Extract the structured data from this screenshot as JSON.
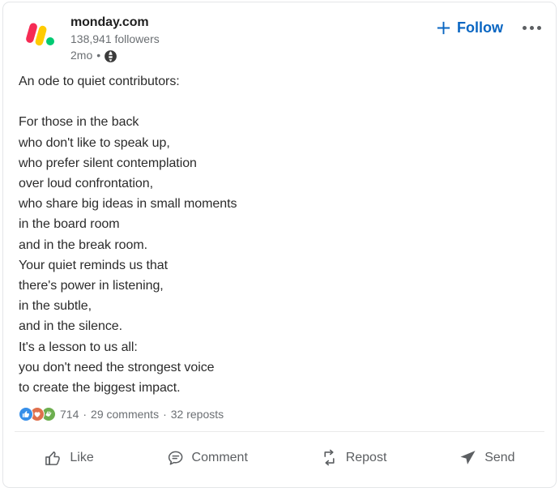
{
  "post": {
    "author": {
      "name": "monday.com",
      "followers": "138,941 followers",
      "timestamp": "2mo",
      "separator": "•",
      "visibility_icon": "globe-icon",
      "avatar_icon": "monday-logo"
    },
    "header_actions": {
      "follow_label": "Follow",
      "follow_plus_icon": "plus-icon",
      "follow_color": "#0a66c2",
      "menu_icon": "overflow-menu-icon"
    },
    "content": "An ode to quiet contributors:\n\nFor those in the back\nwho don't like to speak up,\nwho prefer silent contemplation\nover loud confrontation,\nwho share big ideas in small moments\nin the board room\nand in the break room.\nYour quiet reminds us that\nthere's power in listening,\nin the subtle,\nand in the silence.\nIt's a lesson to us all:\nyou don't need the strongest voice\nto create the biggest impact.",
    "social": {
      "reactions": [
        {
          "name": "like-reaction-icon",
          "color": "#378fe9"
        },
        {
          "name": "love-reaction-icon",
          "color": "#df704d"
        },
        {
          "name": "support-reaction-icon",
          "color": "#6dae4f"
        }
      ],
      "reaction_count": "714",
      "dot_one": "·",
      "comments": "29 comments",
      "dot_two": "·",
      "reposts": "32 reposts"
    },
    "actions": [
      {
        "label": "Like",
        "icon": "thumbs-up-icon"
      },
      {
        "label": "Comment",
        "icon": "speech-bubble-icon"
      },
      {
        "label": "Repost",
        "icon": "repost-arrows-icon"
      },
      {
        "label": "Send",
        "icon": "paper-plane-icon"
      }
    ]
  }
}
